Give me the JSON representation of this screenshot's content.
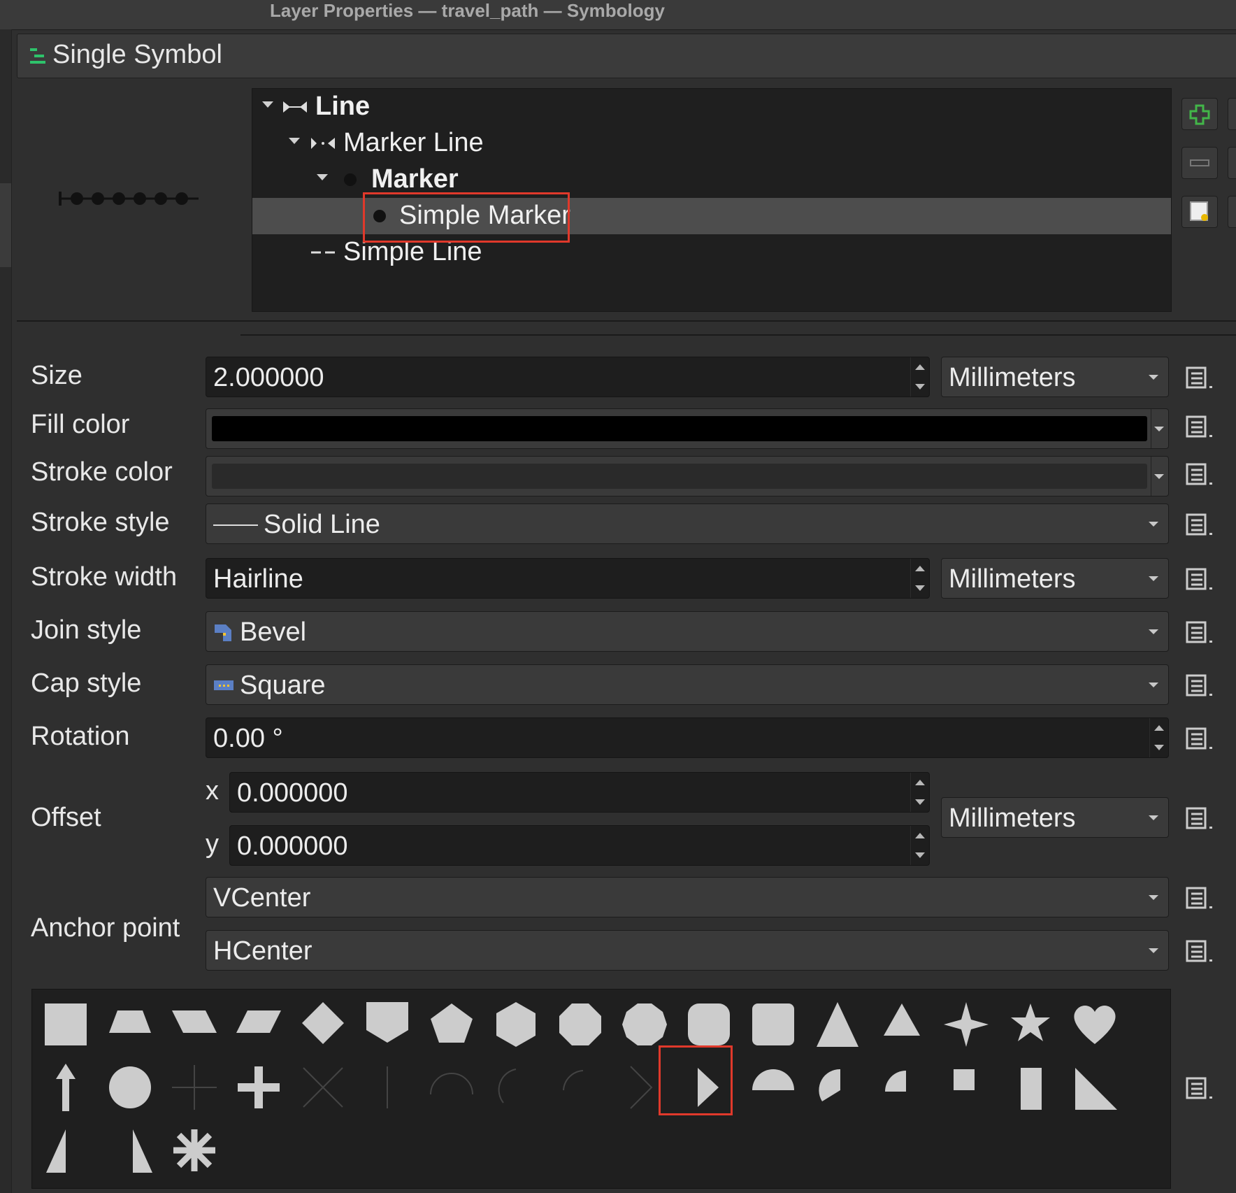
{
  "window": {
    "title": "Layer Properties — travel_path — Symbology"
  },
  "renderer": {
    "type_label": "Single Symbol"
  },
  "symbol_tree": {
    "line": "Line",
    "marker_line": "Marker Line",
    "marker": "Marker",
    "simple_marker": "Simple Marker",
    "simple_line": "Simple Line"
  },
  "properties": {
    "size": {
      "label": "Size",
      "value": "2.000000",
      "unit": "Millimeters"
    },
    "fill_color": {
      "label": "Fill color",
      "color": "#000000"
    },
    "stroke_color": {
      "label": "Stroke color",
      "color": "#2a2a2a"
    },
    "stroke_style": {
      "label": "Stroke style",
      "value": "Solid Line"
    },
    "stroke_width": {
      "label": "Stroke width",
      "value": "Hairline",
      "unit": "Millimeters"
    },
    "join_style": {
      "label": "Join style",
      "value": "Bevel"
    },
    "cap_style": {
      "label": "Cap style",
      "value": "Square"
    },
    "rotation": {
      "label": "Rotation",
      "value": "0.00 °"
    },
    "offset": {
      "label": "Offset",
      "x_label": "x",
      "y_label": "y",
      "x": "0.000000",
      "y": "0.000000",
      "unit": "Millimeters"
    },
    "anchor_point": {
      "label": "Anchor point",
      "vertical": "VCenter",
      "horizontal": "HCenter"
    }
  },
  "shapes": {
    "selected": "arrowhead-filled",
    "items": [
      "square",
      "trapezoid",
      "parallelogram-right",
      "parallelogram-left",
      "diamond",
      "shield",
      "pentagon",
      "hexagon",
      "octagon",
      "decagon",
      "rounded-octagon",
      "rounded-square",
      "triangle",
      "equilateral-triangle",
      "star-4",
      "star-5",
      "heart",
      "arrow",
      "circle",
      "cross",
      "cross-fill",
      "x",
      "line",
      "semi-arc",
      "third-arc",
      "quarter-arc",
      "arrowhead",
      "arrowhead-filled",
      "semi-circle",
      "third-circle",
      "quarter-circle",
      "quarter-square",
      "half-square",
      "diagonal-half-square",
      "right-half-triangle",
      "left-half-triangle",
      "asterisk-fill"
    ]
  },
  "colors": {
    "accent_highlight": "#e0392b",
    "add_icon": "#43b649"
  }
}
